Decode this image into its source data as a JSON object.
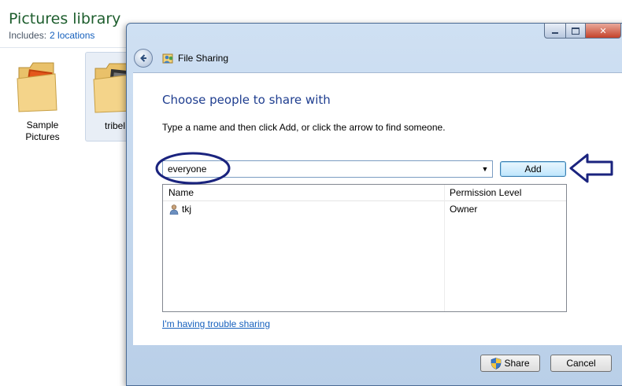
{
  "explorer": {
    "title": "Pictures library",
    "includes_label": "Includes:",
    "locations_link": "2 locations",
    "folders": [
      {
        "label_line1": "Sample",
        "label_line2": "Pictures"
      },
      {
        "label_line1": "tribel"
      }
    ]
  },
  "dialog": {
    "title": "File Sharing",
    "heading": "Choose people to share with",
    "instruction": "Type a name and then click Add, or click the arrow to find someone.",
    "input_value": "everyone",
    "add_label": "Add",
    "table": {
      "columns": [
        "Name",
        "Permission Level"
      ],
      "rows": [
        {
          "name": "tkj",
          "permission": "Owner"
        }
      ]
    },
    "trouble_link": "I'm having trouble sharing",
    "share_label": "Share",
    "cancel_label": "Cancel"
  },
  "colors": {
    "heading": "#1e3d8f",
    "link": "#1560bd",
    "annotation": "#1a237e",
    "library_title": "#1e5e2e"
  }
}
